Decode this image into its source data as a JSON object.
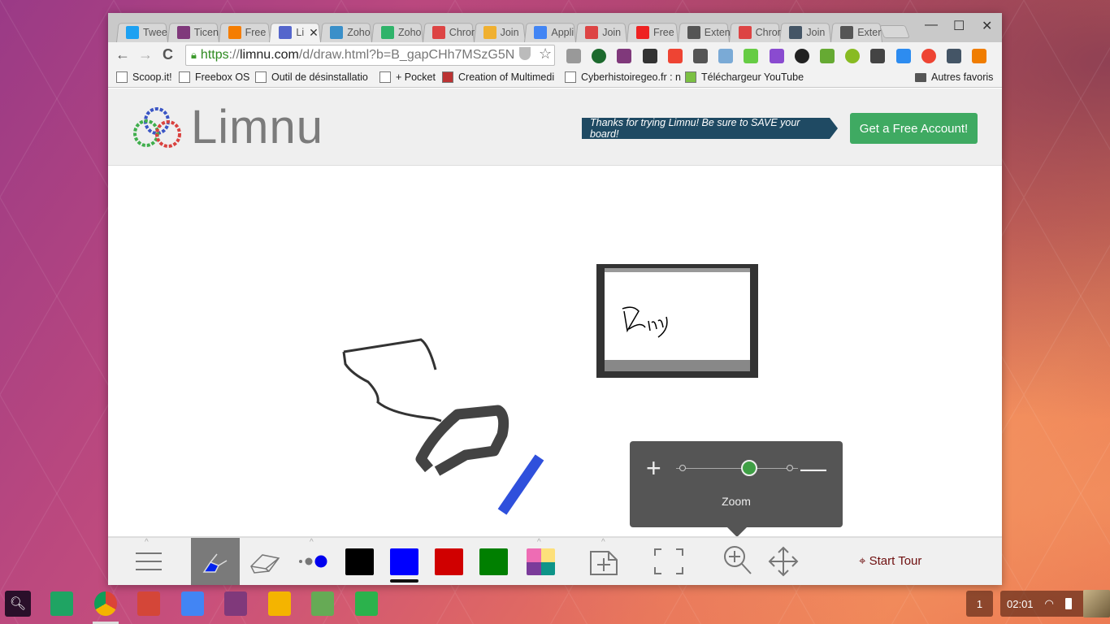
{
  "browser": {
    "tabs": [
      {
        "label": "Twee",
        "icon": "twitter-icon",
        "color": "#1da1f2"
      },
      {
        "label": "Ticen",
        "icon": "onenote-icon",
        "color": "#80397b"
      },
      {
        "label": "Free",
        "icon": "blogger-icon",
        "color": "#f57d00"
      },
      {
        "label": "Li",
        "icon": "limnu-icon",
        "color": "#5566cc",
        "active": true
      },
      {
        "label": "Zoho",
        "icon": "zoho-flow-icon",
        "color": "#3a8fc9"
      },
      {
        "label": "Zoho",
        "icon": "zoho-icon",
        "color": "#2fb36a"
      },
      {
        "label": "Chror",
        "icon": "webstore-icon",
        "color": "#d44"
      },
      {
        "label": "Join",
        "icon": "join-icon",
        "color": "#f0b030"
      },
      {
        "label": "Appli",
        "icon": "google-icon",
        "color": "#4285f4"
      },
      {
        "label": "Join",
        "icon": "webstore-icon",
        "color": "#d44"
      },
      {
        "label": "Free",
        "icon": "heart-icon",
        "color": "#e22"
      },
      {
        "label": "Exten",
        "icon": "puzzle-icon",
        "color": "#555"
      },
      {
        "label": "Chror",
        "icon": "webstore-icon",
        "color": "#d44"
      },
      {
        "label": "Join",
        "icon": "join-app-icon",
        "color": "#456"
      },
      {
        "label": "Exter",
        "icon": "puzzle-icon",
        "color": "#555"
      }
    ],
    "tab_close": "✕",
    "window_controls": {
      "minimize": "—",
      "maximize": "☐",
      "close": "✕"
    },
    "nav": {
      "back": "←",
      "forward": "→",
      "reload": "C"
    },
    "url": {
      "scheme": "https",
      "sep": "://",
      "host": "limnu.com",
      "path": "/d/draw.html?b=B_gapCHh7MSzG5N"
    },
    "star": "☆",
    "extensions": [
      {
        "name": "ext-grey-icon",
        "color": "#999"
      },
      {
        "name": "ext-download-icon",
        "color": "#1d6a2e"
      },
      {
        "name": "ext-onenote-icon",
        "color": "#80397b"
      },
      {
        "name": "ext-film-icon",
        "color": "#333"
      },
      {
        "name": "ext-asterisk-icon",
        "color": "#e43"
      },
      {
        "name": "ext-copy-icon",
        "color": "#555"
      },
      {
        "name": "ext-camera-icon",
        "color": "#7aaad6"
      },
      {
        "name": "ext-green-arrow-icon",
        "color": "#6c4"
      },
      {
        "name": "ext-feather-icon",
        "color": "#8a4bd0"
      },
      {
        "name": "ext-lens-icon",
        "color": "#222"
      },
      {
        "name": "ext-print-icon",
        "color": "#6a3"
      },
      {
        "name": "ext-green-dot-icon",
        "color": "#8b2"
      },
      {
        "name": "ext-chat-icon",
        "color": "#444"
      },
      {
        "name": "ext-cat-icon",
        "color": "#2d8cf0"
      },
      {
        "name": "ext-eye-icon",
        "color": "#e43"
      },
      {
        "name": "ext-join-icon",
        "color": "#456"
      },
      {
        "name": "menu-icon",
        "color": "#f07d00"
      }
    ],
    "bookmarks": [
      {
        "label": "Scoop.it!",
        "icon": "page-icon"
      },
      {
        "label": "Freebox OS",
        "icon": "freebox-icon"
      },
      {
        "label": "Outil de désinstallatio",
        "icon": "java-icon"
      },
      {
        "label": "+ Pocket",
        "icon": "page-icon"
      },
      {
        "label": "Creation of Multimedi",
        "icon": "multimedia-icon"
      },
      {
        "label": "Cyberhistoiregeo.fr : n",
        "icon": "fox-icon"
      },
      {
        "label": "Téléchargeur YouTube",
        "icon": "download-arrow-icon"
      }
    ],
    "other_bookmarks": "Autres favoris"
  },
  "page": {
    "logo_text": "Limnu",
    "banner": "Thanks for trying Limnu! Be sure to SAVE your board!",
    "cta": "Get a Free Account!",
    "zoom_popup": {
      "plus": "+",
      "minus": "—",
      "label": "Zoom",
      "level": 0.6
    },
    "toolbar": {
      "colors": [
        {
          "name": "black",
          "hex": "#000000"
        },
        {
          "name": "blue",
          "hex": "#0000ff",
          "selected": true
        },
        {
          "name": "red",
          "hex": "#d00000"
        },
        {
          "name": "green",
          "hex": "#007f00"
        }
      ],
      "palette_colors": [
        "#ee6cb4",
        "#fde07a",
        "#7b3b9a",
        "#0e9488"
      ],
      "start_tour": "Start Tour"
    }
  },
  "shelf": {
    "apps": [
      {
        "name": "google-drive-icon",
        "color": "#1fa463"
      },
      {
        "name": "chrome-icon",
        "color": "#dd4b39"
      },
      {
        "name": "gmail-icon",
        "color": "#d44638"
      },
      {
        "name": "google-docs-icon",
        "color": "#4285f4"
      },
      {
        "name": "onenote-icon",
        "color": "#80397b"
      },
      {
        "name": "google-slides-icon",
        "color": "#f4b400"
      },
      {
        "name": "app-green-arrows-icon",
        "color": "#6a5"
      },
      {
        "name": "feedly-icon",
        "color": "#2bb24c"
      }
    ],
    "notification_count": "1",
    "time": "02:01"
  }
}
